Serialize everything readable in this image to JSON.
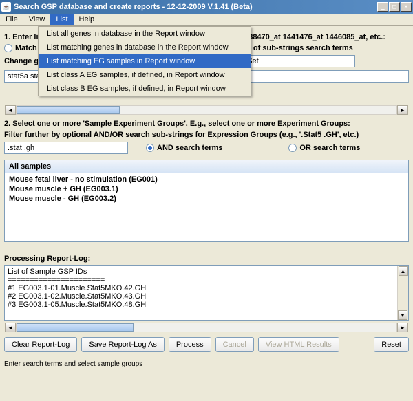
{
  "window": {
    "title": "Search GSP database and create reports - 12-12-2009 V.1.41 (Beta)"
  },
  "menu": {
    "file": "File",
    "view": "View",
    "list": "List",
    "help": "Help",
    "dropdown": [
      "List all genes in database in the Report window",
      "List matching genes in database in the Report window",
      "List matching EG samples in Report window",
      "List class A EG samples, if defined, in Report window",
      "List class B EG samples, if defined, in Report window"
    ]
  },
  "step1": {
    "label": "1. Enter list o",
    "tail": "438470_at 1441476_at 1446085_at, etc.:",
    "match": "Match lis",
    "subsearch": "st of sub-strings search terms",
    "change": "Change gene",
    "change_val": "aSet",
    "input": "stat5a stat5b"
  },
  "step2": {
    "label": "2. Select one or more 'Sample Experiment Groups'. E.g., select one or more Experiment Groups:",
    "filter": "Filter further by optional AND/OR search sub-strings for Expression Groups (e.g., '.Stat5 .GH', etc.)",
    "input": ".stat .gh",
    "and": "AND search terms",
    "or": "OR search terms"
  },
  "samples": {
    "header": "All samples",
    "rows": [
      "Mouse fetal liver - no stimulation (EG001)",
      "Mouse muscle + GH (EG003.1)",
      "Mouse muscle - GH (EG003.2)"
    ]
  },
  "log": {
    "label": "Processing Report-Log:",
    "lines": [
      "List of Sample GSP IDs",
      "======================",
      "#1   EG003.1-01.Muscle.Stat5MKO.42.GH",
      "#2   EG003.1-02.Muscle.Stat5MKO.43.GH",
      "#3   EG003.1-05.Muscle.Stat5MKO.48.GH"
    ]
  },
  "buttons": {
    "clear": "Clear Report-Log",
    "save": "Save Report-Log As",
    "process": "Process",
    "cancel": "Cancel",
    "view": "View HTML Results",
    "reset": "Reset"
  },
  "status": "Enter search terms and select sample groups"
}
